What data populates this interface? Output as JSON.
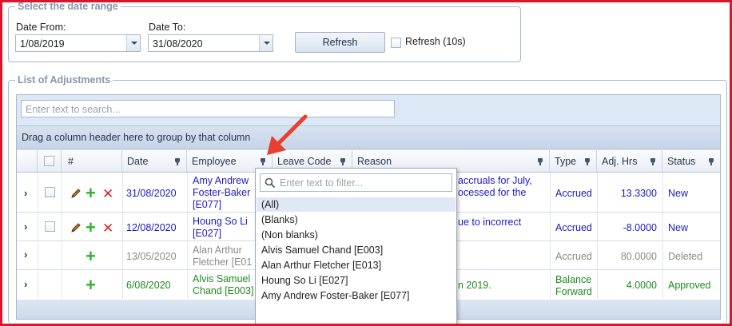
{
  "date_range": {
    "legend": "Select the date range",
    "date_from_label": "Date From:",
    "date_from_value": "1/08/2019",
    "date_to_label": "Date To:",
    "date_to_value": "31/08/2020",
    "refresh_label": "Refresh",
    "auto_refresh_label": "Refresh (10s)"
  },
  "adjustments": {
    "legend": "List of Adjustments",
    "search_placeholder": "Enter text to search...",
    "group_hint": "Drag a column header here to group by that column",
    "columns": [
      "#",
      "Date",
      "Employee",
      "Leave Code",
      "Reason",
      "Type",
      "Adj. Hrs",
      "Status"
    ],
    "rows": [
      {
        "date": "31/08/2020",
        "employee_line1": "Amy Andrew",
        "employee_line2": "Foster-Baker",
        "employee_line3": "[E077]",
        "reason_line1": "accruals for July,",
        "reason_line2": "ocessed for the",
        "type": "Accrued",
        "hours": "13.3300",
        "status": "New"
      },
      {
        "date": "12/08/2020",
        "employee_line1": "Houng So Li",
        "employee_line2": "[E027]",
        "reason_line1": "ue to incorrect",
        "type": "Accrued",
        "hours": "-8.0000",
        "status": "New"
      },
      {
        "date": "13/05/2020",
        "employee_line1": "Alan Arthur",
        "employee_line2": "Fletcher [E01",
        "type": "Accrued",
        "hours": "80.0000",
        "status": "Deleted"
      },
      {
        "date": "6/08/2020",
        "employee_line1": "Alvis Samuel",
        "employee_line2": "Chand [E003]",
        "reason_line1": "n 2019.",
        "type_line1": "Balance",
        "type_line2": "Forward",
        "hours": "4.0000",
        "status": "Approved"
      }
    ]
  },
  "filter_popup": {
    "placeholder": "Enter text to filter...",
    "items": [
      "(All)",
      "(Blanks)",
      "(Non blanks)",
      "Alvis Samuel Chand [E003]",
      "Alan Arthur Fletcher [E013]",
      "Houng So Li [E027]",
      "Amy Andrew Foster-Baker [E077]"
    ]
  },
  "colors": {
    "frame": "#d9172b",
    "link_blue": "#1a1ac8",
    "approved_green": "#1f8a1f",
    "deleted_gray": "#8a8a8a",
    "arrow_red": "#e8402d"
  }
}
